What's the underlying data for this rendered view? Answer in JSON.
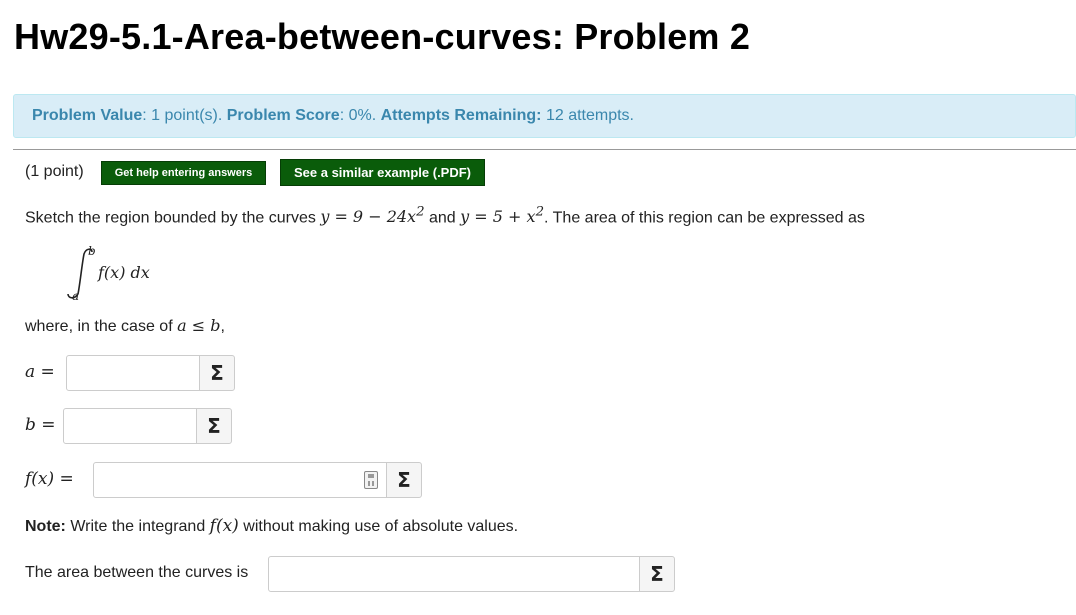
{
  "header": {
    "title": "Hw29-5.1-Area-between-curves: Problem 2"
  },
  "info": {
    "value_label": "Problem Value",
    "value_text": ": 1 point(s). ",
    "score_label": "Problem Score",
    "score_text": ": 0%. ",
    "attempts_label": "Attempts Remaining:",
    "attempts_text": " 12 attempts."
  },
  "problem": {
    "points": "(1 point)",
    "help_button": "Get help entering answers",
    "example_button": "See a similar example (.PDF)",
    "sentence_pre": "Sketch the region bounded by the curves ",
    "curve1": "y = 9 − 24x",
    "curve1_exp": "2",
    "and_text": " and ",
    "curve2": "y = 5 + x",
    "curve2_exp": "2",
    "sentence_post": ". The area of this region can be expressed as",
    "integral_upper": "b",
    "integral_lower": "a",
    "integrand": "f(x) dx",
    "where_pre": "where, in the case of ",
    "where_math": "a ≤ b",
    "where_post": ",",
    "a_label": "a =",
    "b_label": "b =",
    "f_label": "f(x) =",
    "note_bold": "Note:",
    "note_pre": " Write the integrand ",
    "note_math": "f(x)",
    "note_post": " without making use of absolute values.",
    "area_label": "The area between the curves is",
    "sigma": "Σ",
    "a_value": "",
    "b_value": "",
    "f_value": "",
    "area_value": ""
  },
  "colors": {
    "info_bg": "#d9edf7",
    "info_text": "#3a87ad",
    "button_green": "#0a5c0a"
  }
}
